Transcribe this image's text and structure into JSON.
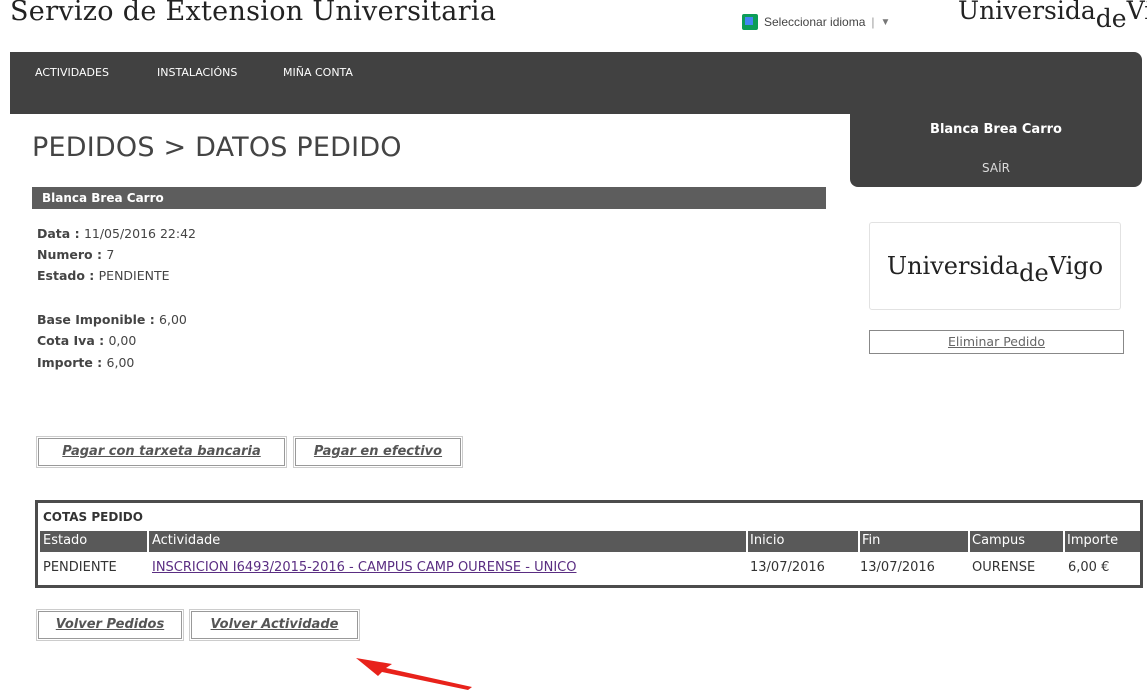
{
  "header": {
    "site_title": "Servizo de Extension Universitaria",
    "language_selector": "Seleccionar idioma",
    "logo": {
      "part1": "Universida",
      "part2": "de",
      "part3": "Vigo"
    }
  },
  "nav": {
    "items": [
      "ACTIVIDADES",
      "INSTALACIÓNS",
      "MIÑA CONTA"
    ]
  },
  "user": {
    "name": "Blanca Brea Carro",
    "exit_label": "SAÍR"
  },
  "page": {
    "breadcrumb": "PEDIDOS > DATOS PEDIDO",
    "customer_bar": "Blanca Brea Carro"
  },
  "order": {
    "date_label": "Data : ",
    "date": "11/05/2016 22:42",
    "number_label": "Numero : ",
    "number": "7",
    "status_label": "Estado : ",
    "status": "PENDIENTE",
    "base_label": "Base Imponible : ",
    "base": "6,00",
    "vat_label": "Cota Iva : ",
    "vat": "0,00",
    "amount_label": "Importe : ",
    "amount": "6,00"
  },
  "actions": {
    "delete_order": "Eliminar Pedido",
    "pay_card": "Pagar con tarxeta bancaria",
    "pay_cash": "Pagar en efectivo",
    "back_orders": "Volver Pedidos",
    "back_activity": "Volver Actividade"
  },
  "cotas": {
    "title": "COTAS PEDIDO",
    "headers": [
      "Estado",
      "Actividade",
      "Inicio",
      "Fin",
      "Campus",
      "Importe"
    ],
    "rows": [
      [
        "PENDIENTE",
        "INSCRICION I6493/2015-2016 - CAMPUS CAMP OURENSE - UNICO",
        "13/07/2016",
        "13/07/2016",
        "OURENSE",
        "6,00 €"
      ]
    ]
  },
  "colors": {
    "nav_bg": "#414141",
    "bar_bg": "#5d5d5d",
    "link": "#5a2d82",
    "annotation_arrow": "#e8221b"
  }
}
